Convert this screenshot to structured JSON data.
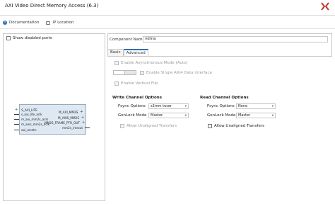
{
  "window": {
    "title": "AXI Video Direct Memory Access (6.3)"
  },
  "toolbar": {
    "documentation": "Documentation",
    "ip_location": "IP Location"
  },
  "left": {
    "show_disabled_ports": "Show disabled ports",
    "ports_left": [
      "S_AXI_LITE",
      "s_axi_lite_aclk",
      "m_axi_mm2s_aclk",
      "m_axis_mm2s_aclk",
      "axi_resetn"
    ],
    "ports_right": [
      "M_AXI_MM2S",
      "M_AXIS_MM2S",
      "MM2S_FRAME_PTR_OUT",
      "mm2s_introut"
    ]
  },
  "component": {
    "label": "Component Name",
    "value": "vdma"
  },
  "tabs": [
    "Basic",
    "Advanced"
  ],
  "advanced": {
    "async_mode": "Enable Asynchronous Mode (Auto)",
    "axi4_single": "Enable Single AXI4 Data interface",
    "vertical_flip": "Enable Vertical Flip"
  },
  "write": {
    "title": "Write Channel Options",
    "fsync_label": "Fsync Options",
    "fsync_value": "s2mm tuser",
    "genlock_label": "GenLock Mode",
    "genlock_value": "Master",
    "unaligned": "Allow Unaligned Transfers"
  },
  "read": {
    "title": "Read Channel Options",
    "fsync_label": "Fsync Options",
    "fsync_value": "None",
    "genlock_label": "GenLock Mode",
    "genlock_value": "Master",
    "unaligned": "Allow Unaligned Transfers"
  }
}
